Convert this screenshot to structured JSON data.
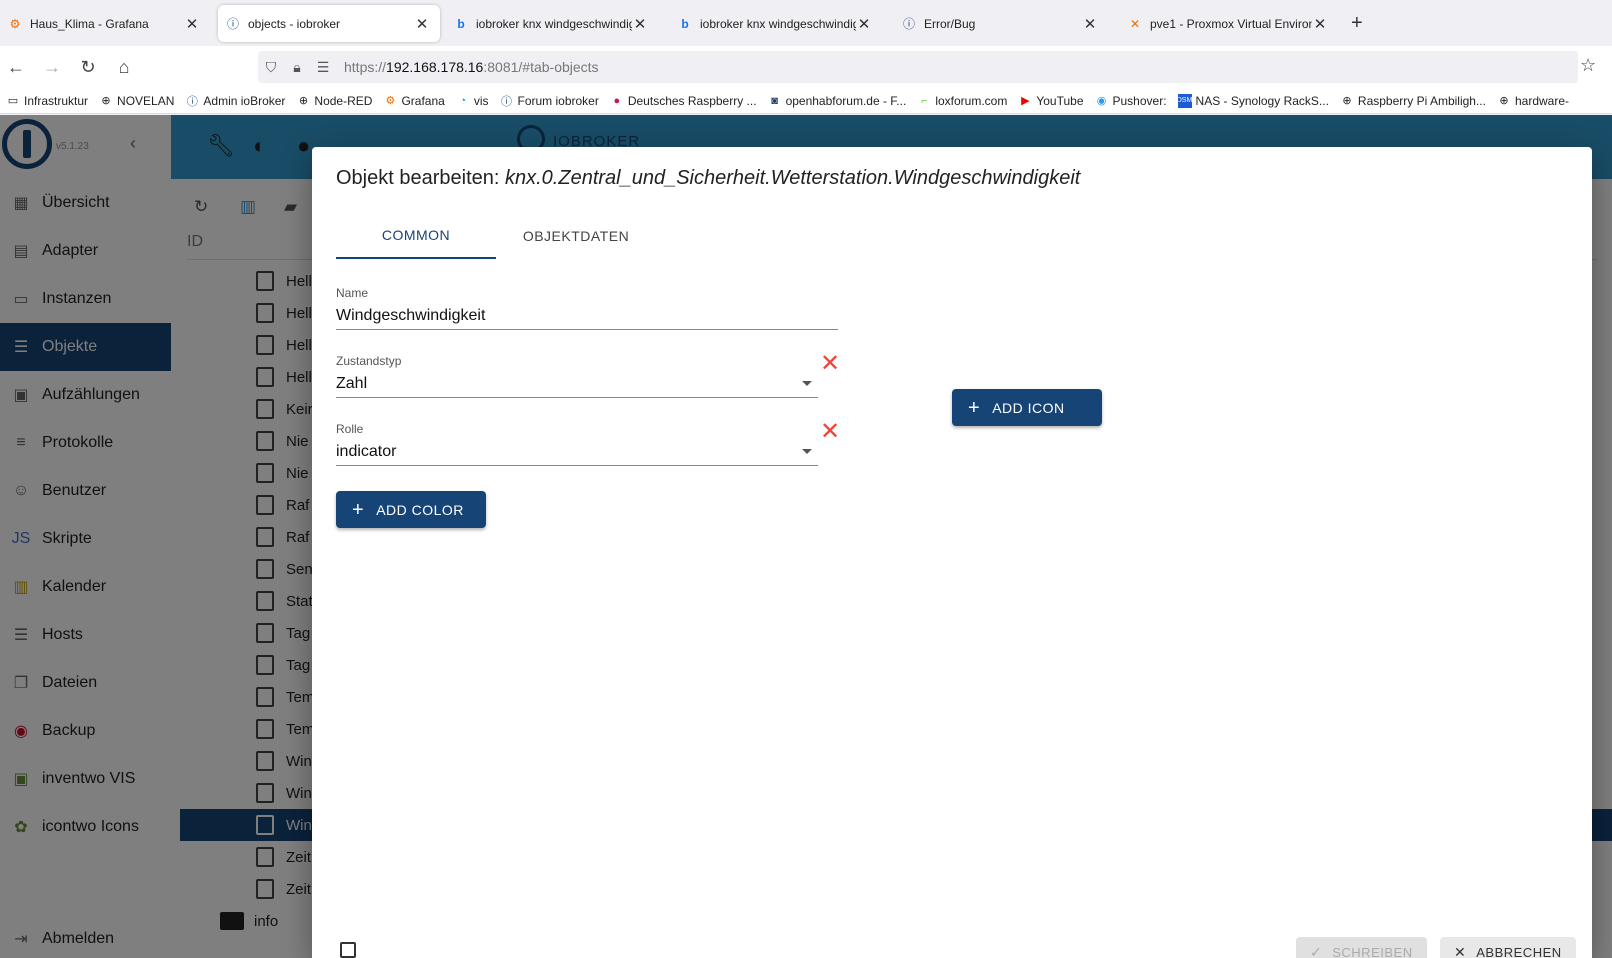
{
  "browser": {
    "tabs": [
      {
        "title": "Haus_Klima - Grafana",
        "icon": "grafana-icon"
      },
      {
        "title": "objects - iobroker",
        "icon": "iobroker-icon",
        "active": true
      },
      {
        "title": "iobroker knx windgeschwindigk",
        "icon": "bing-icon"
      },
      {
        "title": "iobroker knx windgeschwindigk",
        "icon": "bing-icon"
      },
      {
        "title": "Error/Bug",
        "icon": "iobroker-icon"
      },
      {
        "title": "pve1 - Proxmox Virtual Environ",
        "icon": "proxmox-icon"
      }
    ],
    "url": {
      "scheme": "https://",
      "host": "192.168.178.16",
      "rest": ":8081/#tab-objects"
    },
    "bookmarks": [
      {
        "label": "Infrastruktur",
        "icon": "folder-icon"
      },
      {
        "label": "NOVELAN",
        "icon": "globe-icon"
      },
      {
        "label": "Admin ioBroker",
        "icon": "iobroker-icon"
      },
      {
        "label": "Node-RED",
        "icon": "globe-icon"
      },
      {
        "label": "Grafana",
        "icon": "grafana-icon"
      },
      {
        "label": "vis",
        "icon": "vis-icon"
      },
      {
        "label": "Forum iobroker",
        "icon": "iobroker-icon"
      },
      {
        "label": "Deutsches Raspberry ...",
        "icon": "raspberry-icon"
      },
      {
        "label": "openhabforum.de - F...",
        "icon": "openhab-icon"
      },
      {
        "label": "loxforum.com",
        "icon": "loxone-icon"
      },
      {
        "label": "YouTube",
        "icon": "youtube-icon"
      },
      {
        "label": "Pushover:",
        "icon": "pushover-icon"
      },
      {
        "label": "NAS - Synology RackS...",
        "icon": "synology-icon"
      },
      {
        "label": "Raspberry Pi Ambiligh...",
        "icon": "globe-icon"
      },
      {
        "label": "hardware-",
        "icon": "globe-icon"
      }
    ]
  },
  "app": {
    "version": "v5.1.23",
    "brand": "IOBROKER",
    "sidebar": [
      {
        "label": "Übersicht",
        "icon": "grid-icon"
      },
      {
        "label": "Adapter",
        "icon": "store-icon"
      },
      {
        "label": "Instanzen",
        "icon": "instances-icon"
      },
      {
        "label": "Objekte",
        "icon": "list-icon",
        "active": true
      },
      {
        "label": "Aufzählungen",
        "icon": "enum-icon"
      },
      {
        "label": "Protokolle",
        "icon": "log-icon"
      },
      {
        "label": "Benutzer",
        "icon": "user-icon"
      },
      {
        "label": "Skripte",
        "icon": "js-icon"
      },
      {
        "label": "Kalender",
        "icon": "calendar-icon"
      },
      {
        "label": "Hosts",
        "icon": "hosts-icon"
      },
      {
        "label": "Dateien",
        "icon": "files-icon"
      },
      {
        "label": "Backup",
        "icon": "backup-icon"
      },
      {
        "label": "inventwo VIS",
        "icon": "inventwo-icon"
      },
      {
        "label": "icontwo Icons",
        "icon": "icontwo-icon"
      },
      {
        "label": "Abmelden",
        "icon": "logout-icon"
      }
    ],
    "id_header": "ID",
    "tree_rows": [
      "Hell",
      "Hell",
      "Hell",
      "Hell",
      "Keir",
      "Nie",
      "Nie",
      "Raf",
      "Raf",
      "Sen",
      "Stat",
      "Tag",
      "Tag",
      "Tem",
      "Tem",
      "Win",
      "Win",
      "Win",
      "Zeit",
      "Zeit"
    ],
    "tree_folder": "info"
  },
  "dialog": {
    "title_prefix": "Objekt bearbeiten: ",
    "title_id": "knx.0.Zentral_und_Sicherheit.Wetterstation.Windgeschwindigkeit",
    "tabs": [
      "COMMON",
      "OBJEKTDATEN"
    ],
    "name_label": "Name",
    "name_value": "Windgeschwindigkeit",
    "type_label": "Zustandstyp",
    "type_value": "Zahl",
    "role_label": "Rolle",
    "role_value": "indicator",
    "add_color": "ADD COLOR",
    "add_icon": "ADD ICON",
    "write_label": "SCHREIBEN",
    "cancel_label": "ABBRECHEN"
  }
}
